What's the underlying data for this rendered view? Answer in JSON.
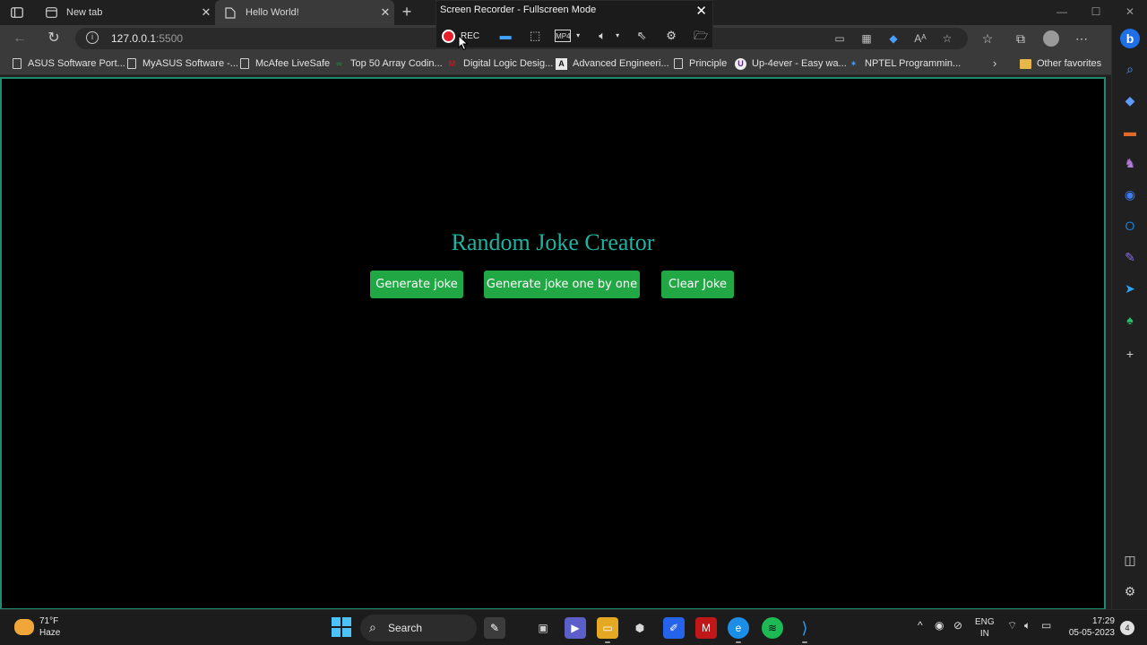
{
  "browser": {
    "tabs": [
      {
        "title": "New tab",
        "active": false
      },
      {
        "title": "Hello World!",
        "active": true
      }
    ],
    "address": {
      "host": "127.0.0.1",
      "port": ":5500"
    },
    "bookmarks": [
      {
        "label": "ASUS Software Port...",
        "icon": "doc-icon"
      },
      {
        "label": "MyASUS Software -...",
        "icon": "doc-icon"
      },
      {
        "label": "McAfee LiveSafe",
        "icon": "doc-icon"
      },
      {
        "label": "Top 50 Array Codin...",
        "icon": "gfg-icon"
      },
      {
        "label": "Digital Logic Desig...",
        "icon": "m-icon"
      },
      {
        "label": "Advanced Engineeri...",
        "icon": "a-icon"
      },
      {
        "label": "Principle",
        "icon": "doc-icon"
      },
      {
        "label": "Up-4ever - Easy wa...",
        "icon": "u-icon"
      },
      {
        "label": "NPTEL Programmin...",
        "icon": "nptel-icon"
      }
    ],
    "other_favorites": "Other favorites"
  },
  "recorder": {
    "title": "Screen Recorder - Fullscreen Mode",
    "rec_label": "REC",
    "format_label": "MP4"
  },
  "page": {
    "heading": "Random Joke Creator",
    "buttons": {
      "generate": "Generate joke",
      "generate_one_by_one": "Generate joke one by one",
      "clear": "Clear Joke"
    },
    "colors": {
      "heading": "#20b2a0",
      "button": "#22a745",
      "border": "#1e8a6e"
    }
  },
  "taskbar": {
    "weather_temp": "71°F",
    "weather_desc": "Haze",
    "search_label": "Search",
    "lang_line1": "ENG",
    "lang_line2": "IN",
    "time": "17:29",
    "date": "05-05-2023",
    "notification_count": "4"
  }
}
